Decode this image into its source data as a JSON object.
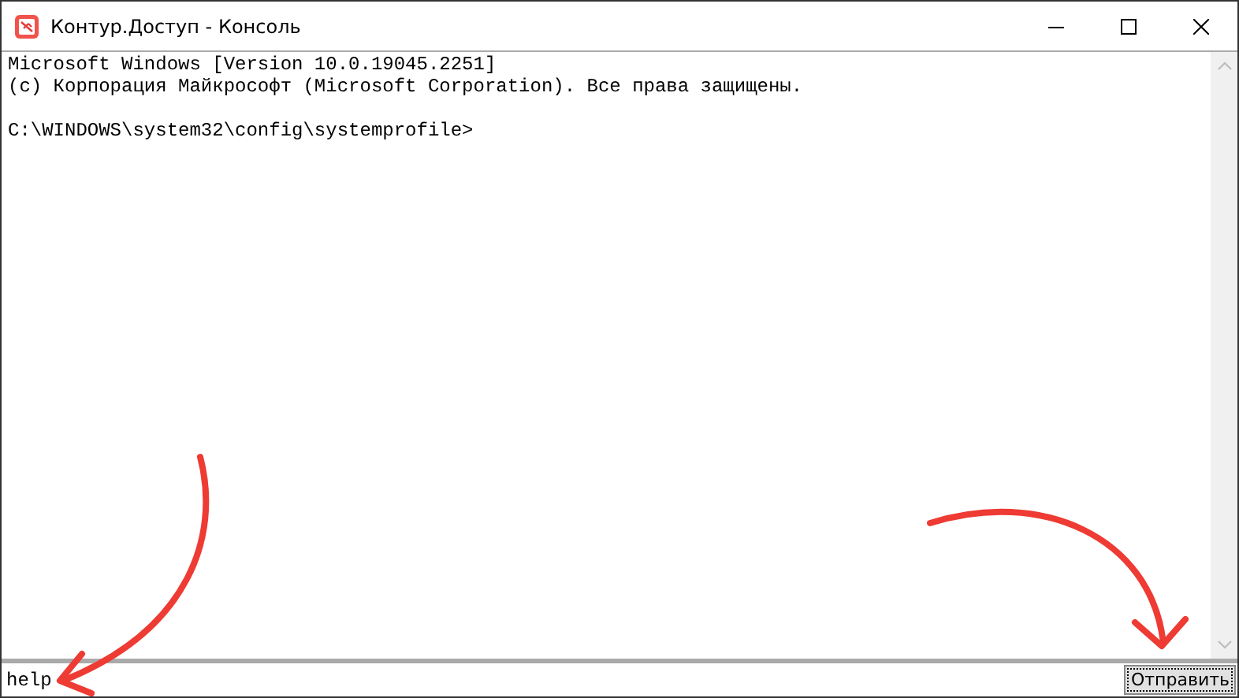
{
  "window": {
    "title": "Контур.Доступ - Консоль"
  },
  "console": {
    "output": [
      [
        "Microsoft Windows [Version 10.0.19045.2251]",
        "(c) Корпорация Майкрософт (Microsoft Corporation). Все права защищены."
      ],
      [
        "C:\\WINDOWS\\system32\\config\\systemprofile>"
      ]
    ]
  },
  "command": {
    "value": "help"
  },
  "send_button": {
    "label": "Отправить"
  }
}
